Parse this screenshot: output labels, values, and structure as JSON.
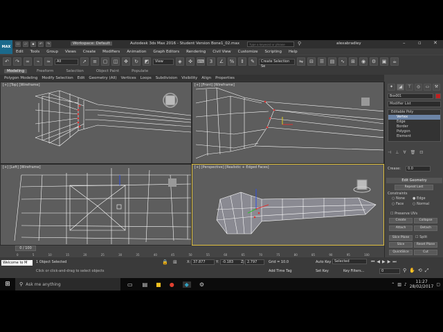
{
  "window": {
    "workspace_label": "Workspace: Default",
    "title": "Autodesk 3ds Max 2016 - Student Version   Bone1_02.max",
    "search_placeholder": "Type a keyword or phrase",
    "user": "alexabradley"
  },
  "logo": "MAX",
  "menu": [
    "Edit",
    "Tools",
    "Group",
    "Views",
    "Create",
    "Modifiers",
    "Animation",
    "Graph Editors",
    "Rendering",
    "Civil View",
    "Customize",
    "Scripting",
    "Help"
  ],
  "toolbar": {
    "filter_value": "All",
    "ref_coord": "View",
    "selection_set": "Create Selection Se"
  },
  "ribbon": {
    "tabs": [
      "Modeling",
      "Freeform",
      "Selection",
      "Object Paint",
      "Populate"
    ],
    "active_tab": "Modeling",
    "panels": [
      "Polygon Modeling",
      "Modify Selection",
      "Edit",
      "Geometry (All)",
      "Vertices",
      "Loops",
      "Subdivision",
      "Visibility",
      "Align",
      "Properties"
    ]
  },
  "viewports": {
    "top": "[+] [Top] [Wireframe]",
    "front": "[+] [Front] [Wireframe]",
    "left": "[+] [Left] [Wireframe]",
    "perspective": "[+] [Perspective] [Realistic + Edged Faces]"
  },
  "command_panel": {
    "object_name": "Box001",
    "modifier_list": "Modifier List",
    "stack": [
      "Editable Poly",
      "Vertex",
      "Edge",
      "Border",
      "Polygon",
      "Element"
    ],
    "stack_selected": "Vertex",
    "crease_label": "Crease:",
    "crease_value": "0.0",
    "rollout": "Edit Geometry",
    "repeat_last": "Repeat Last",
    "constraints": "Constraints",
    "constraint_opts": [
      "None",
      "Edge",
      "Face",
      "Normal"
    ],
    "preserve_uvs": "Preserve UVs",
    "create": "Create",
    "collapse": "Collapse",
    "attach": "Attach",
    "detach": "Detach",
    "slice_plane": "Slice Plane",
    "split": "Split",
    "slice": "Slice",
    "reset_plane": "Reset Plane",
    "quickslice": "QuickSlice",
    "cut": "Cut"
  },
  "timeline": {
    "frame": "0 / 100",
    "ticks": [
      "0",
      "5",
      "10",
      "15",
      "20",
      "25",
      "30",
      "35",
      "40",
      "45",
      "50",
      "55",
      "60",
      "65",
      "70",
      "75",
      "80",
      "85",
      "90",
      "95",
      "100"
    ]
  },
  "status": {
    "selection": "1 Object Selected",
    "prompt": "Click or click-and-drag to select objects",
    "listener": "Welcome to M",
    "x_label": "X:",
    "x": "37.877",
    "y_label": "Y:",
    "y": "-0.183",
    "z_label": "Z:",
    "z": "2.797",
    "grid": "Grid = 10.0",
    "add_time_tag": "Add Time Tag",
    "auto_key": "Auto Key",
    "set_key": "Set Key",
    "key_mode": "Selected",
    "key_filters": "Key Filters...",
    "frame_field": "0"
  },
  "taskbar": {
    "search": "Ask me anything",
    "time": "11:27",
    "date": "28/02/2017"
  },
  "colors": {
    "viewport_bg": "#5d5d5d",
    "wire": "#ffffff",
    "selected_vertex": "#e03030",
    "accent": "#1b6a8c"
  }
}
